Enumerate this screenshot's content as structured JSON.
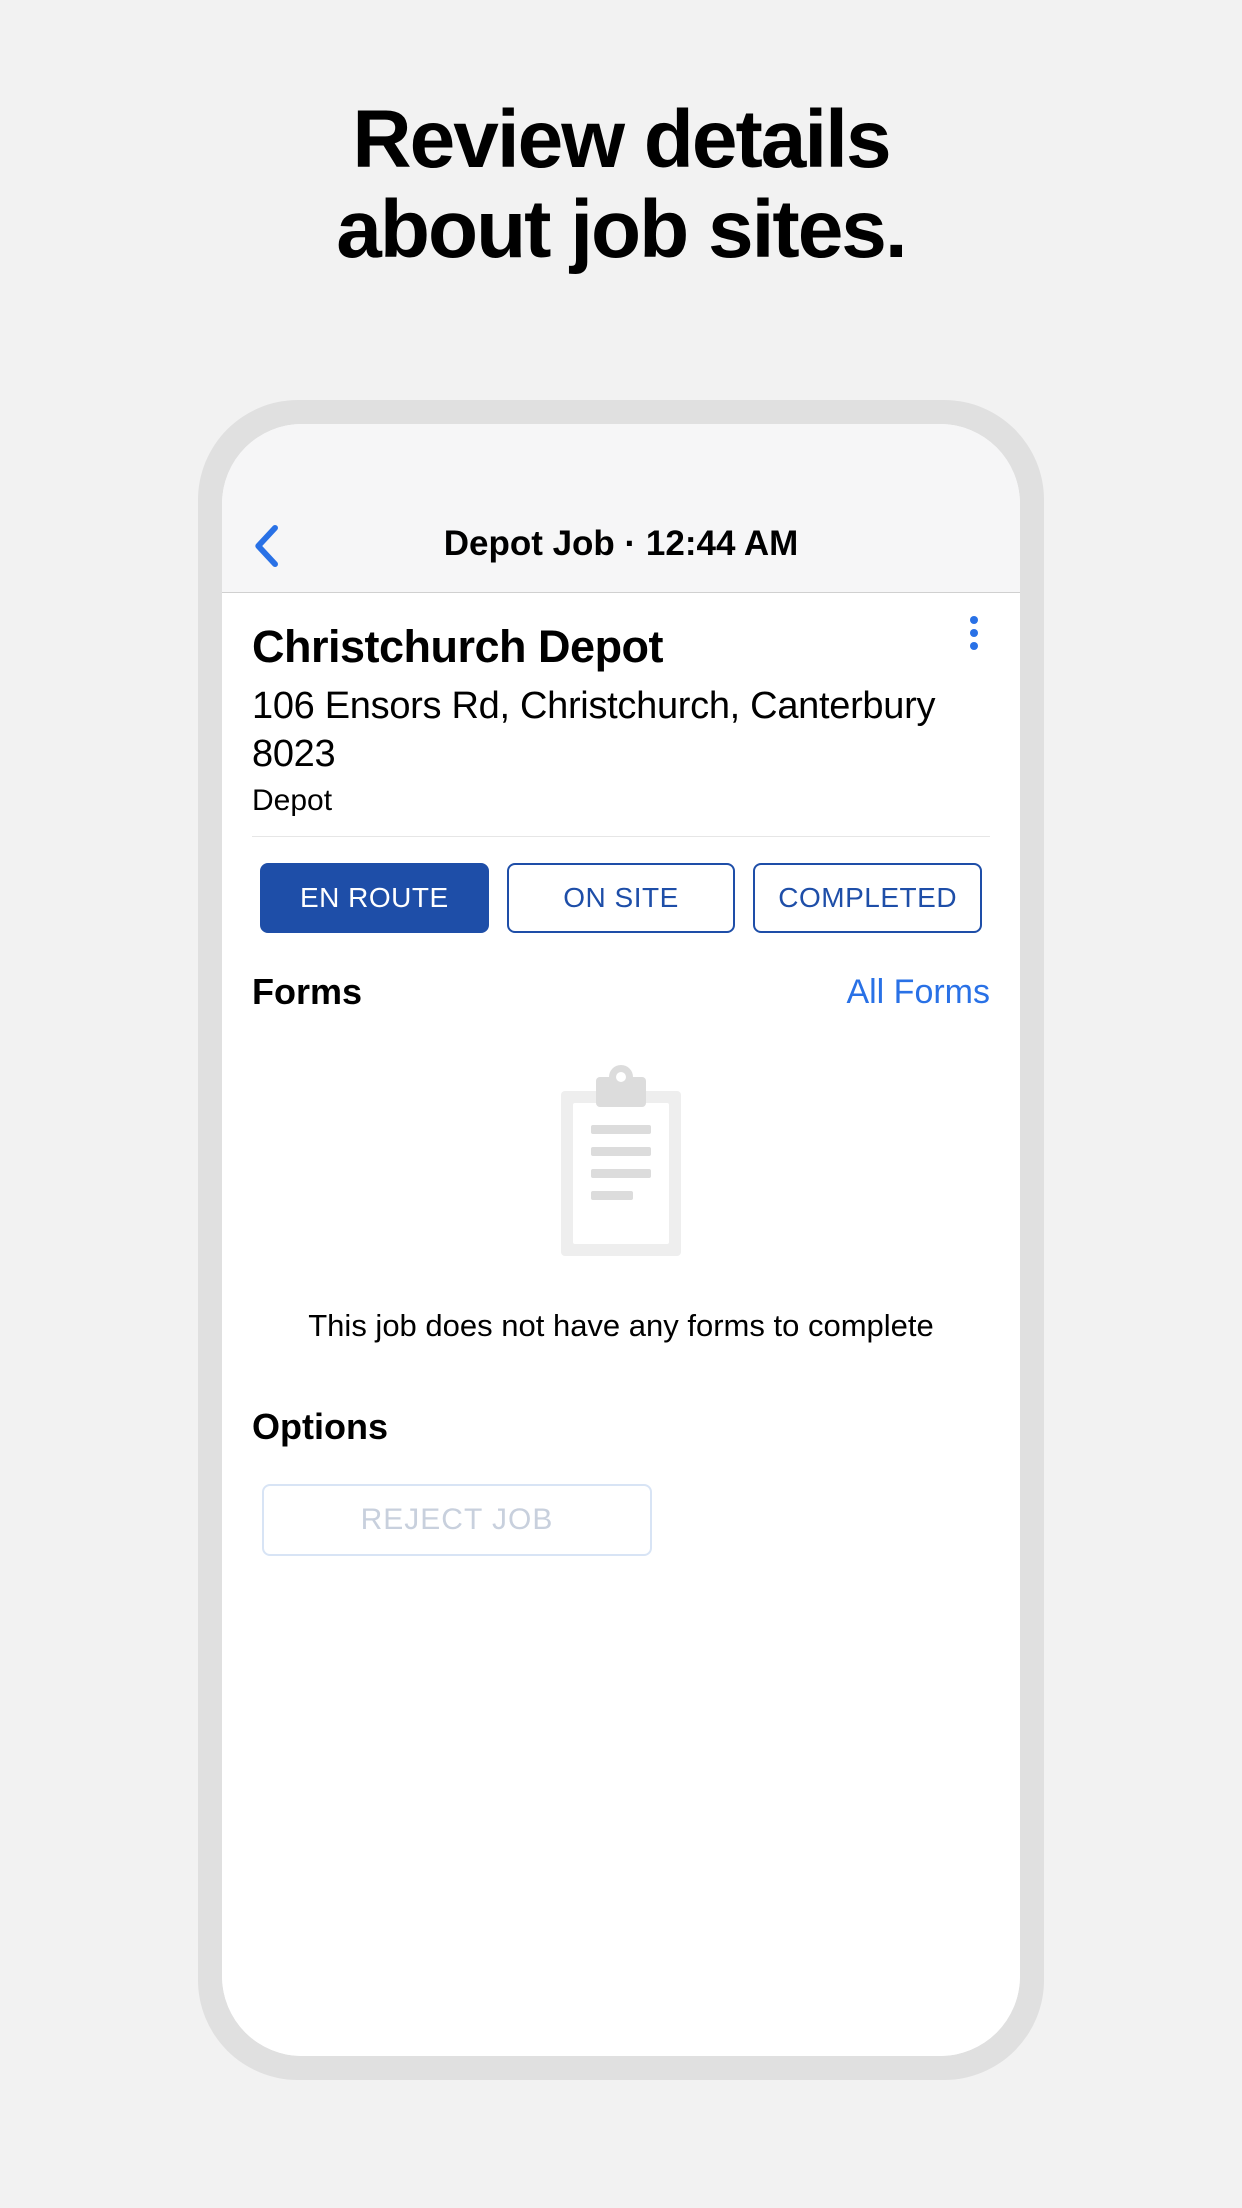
{
  "marketing": {
    "headline_line1": "Review details",
    "headline_line2": "about job sites."
  },
  "nav": {
    "title": "Depot Job · 12:44 AM"
  },
  "job": {
    "title": "Christchurch Depot",
    "address": "106 Ensors Rd, Christchurch, Canterbury 8023",
    "type": "Depot"
  },
  "status": {
    "en_route": "EN ROUTE",
    "on_site": "ON SITE",
    "completed": "COMPLETED"
  },
  "forms": {
    "heading": "Forms",
    "all_link": "All Forms",
    "empty_message": "This job does not have any forms to complete"
  },
  "options": {
    "heading": "Options",
    "reject_label": "REJECT JOB"
  }
}
